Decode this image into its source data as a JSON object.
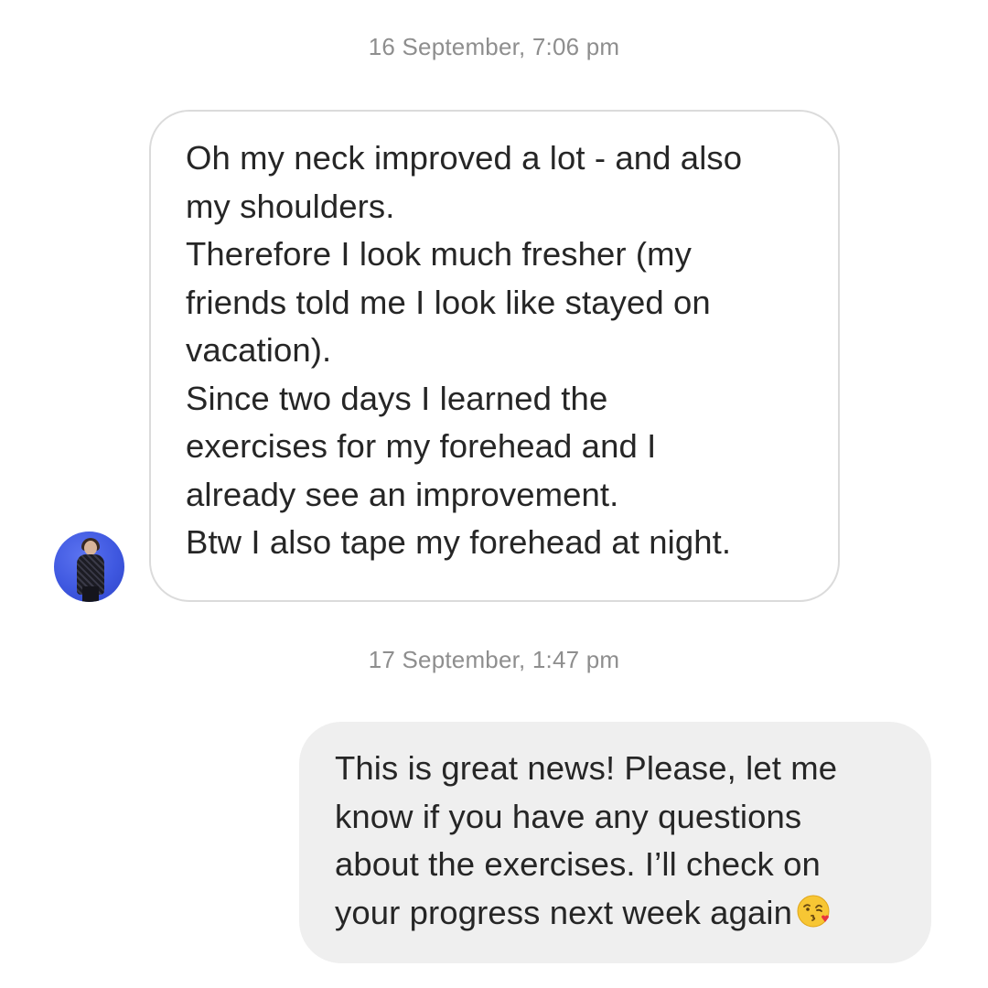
{
  "thread": {
    "timestamp_1": "16 September, 7:06 pm",
    "incoming_message": {
      "lines": [
        "Oh my neck improved a lot - and also",
        "my shoulders.",
        "Therefore I look much fresher (my",
        "friends told me I look like stayed on",
        "vacation).",
        "Since two days I learned the",
        "exercises for my forehead and I",
        "already see an improvement.",
        "Btw I also tape my forehead at night."
      ]
    },
    "timestamp_2": "17 September, 1:47 pm",
    "outgoing_message": {
      "lines": [
        "This is great news! Please, let me",
        "know if you have any questions",
        "about the exercises. I’ll check on",
        "your progress next week again"
      ],
      "emoji": "face-blowing-a-kiss-icon"
    }
  },
  "colors": {
    "timestamp": "#8e8e8e",
    "text": "#262626",
    "incoming_border": "#dbdbdb",
    "outgoing_background": "#efefef",
    "avatar_background": "#4a62e6"
  }
}
